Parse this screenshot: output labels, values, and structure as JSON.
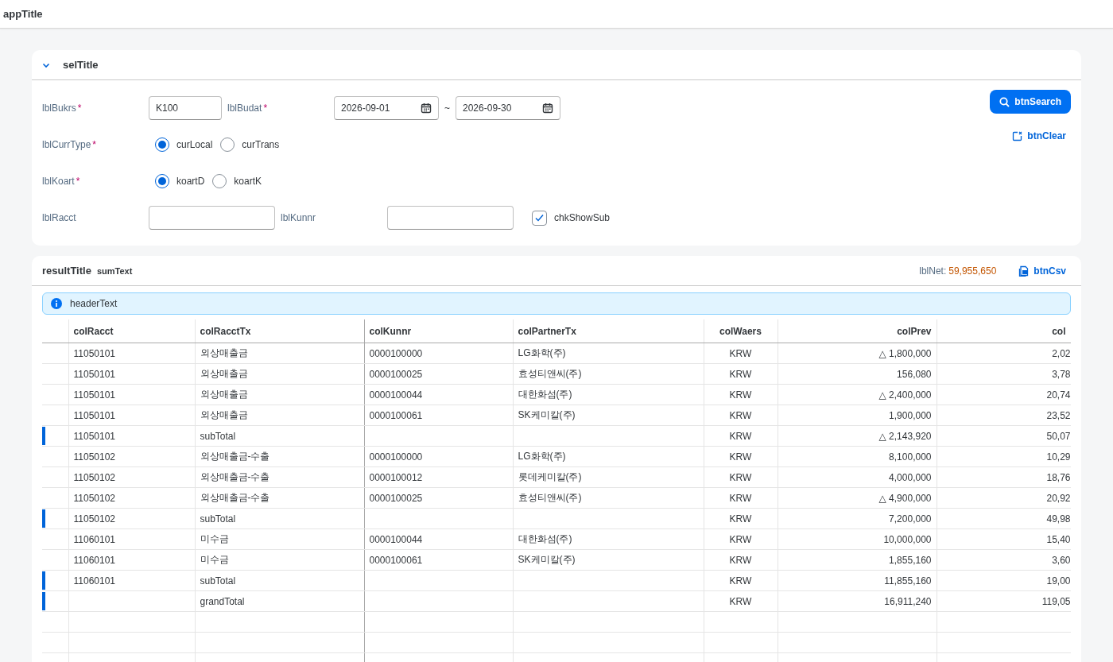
{
  "app": {
    "title": "appTitle"
  },
  "selection": {
    "title": "selTitle",
    "expanded": true,
    "bukrs": {
      "label": "lblBukrs",
      "required_mark": "*",
      "value": "K100"
    },
    "budat": {
      "label": "lblBudat",
      "required_mark": "*",
      "from": "2026-09-01",
      "separator": "~",
      "to": "2026-09-30"
    },
    "curr_type": {
      "label": "lblCurrType",
      "required_mark": "*",
      "options": [
        {
          "label": "curLocal",
          "selected": true
        },
        {
          "label": "curTrans",
          "selected": false
        }
      ]
    },
    "koart": {
      "label": "lblKoart",
      "required_mark": "*",
      "options": [
        {
          "label": "koartD",
          "selected": true
        },
        {
          "label": "koartK",
          "selected": false
        }
      ]
    },
    "racct": {
      "label": "lblRacct"
    },
    "kunnr": {
      "label": "lblKunnr"
    },
    "show_sub": {
      "label": "chkShowSub",
      "checked": true
    },
    "search_button": "btnSearch",
    "clear_button": "btnClear"
  },
  "result": {
    "title": "resultTitle",
    "sum_text": "sumText",
    "net_label": "lblNet:",
    "net_value": "59,955,650",
    "csv_button": "btnCsv",
    "info": "headerText",
    "table": {
      "columns": [
        "colRacct",
        "colRacctTx",
        "colKunnr",
        "colPartnerTx",
        "colWaers",
        "colPrev",
        "col"
      ],
      "rows": [
        {
          "kind": "item",
          "cells": [
            "11050101",
            "외상매출금",
            "0000100000",
            "LG화학(주)",
            "KRW",
            "△ 1,800,000",
            "2,02"
          ]
        },
        {
          "kind": "item",
          "cells": [
            "11050101",
            "외상매출금",
            "0000100025",
            "효성티앤씨(주)",
            "KRW",
            "156,080",
            "3,78"
          ]
        },
        {
          "kind": "item",
          "cells": [
            "11050101",
            "외상매출금",
            "0000100044",
            "대한화섬(주)",
            "KRW",
            "△ 2,400,000",
            "20,74"
          ]
        },
        {
          "kind": "item",
          "cells": [
            "11050101",
            "외상매출금",
            "0000100061",
            "SK케미칼(주)",
            "KRW",
            "1,900,000",
            "23,52"
          ]
        },
        {
          "kind": "subtotal",
          "cells": [
            "11050101",
            "subTotal",
            "",
            "",
            "KRW",
            "△ 2,143,920",
            "50,07"
          ]
        },
        {
          "kind": "item",
          "cells": [
            "11050102",
            "외상매출금-수출",
            "0000100000",
            "LG화학(주)",
            "KRW",
            "8,100,000",
            "10,29"
          ]
        },
        {
          "kind": "item",
          "cells": [
            "11050102",
            "외상매출금-수출",
            "0000100012",
            "롯데케미칼(주)",
            "KRW",
            "4,000,000",
            "18,76"
          ]
        },
        {
          "kind": "item",
          "cells": [
            "11050102",
            "외상매출금-수출",
            "0000100025",
            "효성티앤씨(주)",
            "KRW",
            "△ 4,900,000",
            "20,92"
          ]
        },
        {
          "kind": "subtotal",
          "cells": [
            "11050102",
            "subTotal",
            "",
            "",
            "KRW",
            "7,200,000",
            "49,98"
          ]
        },
        {
          "kind": "item",
          "cells": [
            "11060101",
            "미수금",
            "0000100044",
            "대한화섬(주)",
            "KRW",
            "10,000,000",
            "15,40"
          ]
        },
        {
          "kind": "item",
          "cells": [
            "11060101",
            "미수금",
            "0000100061",
            "SK케미칼(주)",
            "KRW",
            "1,855,160",
            "3,60"
          ]
        },
        {
          "kind": "subtotal",
          "cells": [
            "11060101",
            "subTotal",
            "",
            "",
            "KRW",
            "11,855,160",
            "19,00"
          ]
        },
        {
          "kind": "total",
          "cells": [
            "",
            "grandTotal",
            "",
            "",
            "KRW",
            "16,911,240",
            "119,05"
          ]
        }
      ]
    }
  }
}
